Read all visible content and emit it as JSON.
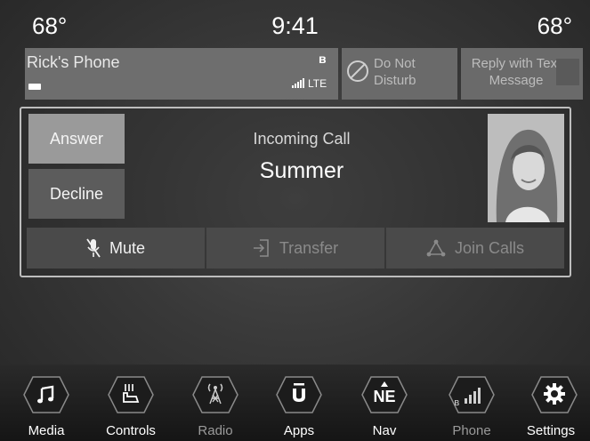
{
  "status_bar": {
    "temp_left": "68°",
    "time": "9:41",
    "temp_right": "68°"
  },
  "phone": {
    "name": "Rick's Phone",
    "network": "LTE",
    "do_not_disturb": "Do Not Disturb",
    "reply_text": "Reply with Text Message"
  },
  "call": {
    "status": "Incoming Call",
    "caller": "Summer",
    "answer_label": "Answer",
    "decline_label": "Decline",
    "mute_label": "Mute",
    "transfer_label": "Transfer",
    "join_label": "Join Calls"
  },
  "dock": [
    {
      "label": "Media",
      "icon": "music-note-icon"
    },
    {
      "label": "Controls",
      "icon": "heated-seat-icon"
    },
    {
      "label": "Radio",
      "icon": "radio-tower-icon"
    },
    {
      "label": "Apps",
      "icon": "apps-icon"
    },
    {
      "label": "Nav",
      "icon": "compass-ne-icon"
    },
    {
      "label": "Phone",
      "icon": "phone-signal-icon"
    },
    {
      "label": "Settings",
      "icon": "gear-icon"
    }
  ],
  "nav_glyph": "NE",
  "colors": {
    "background": "#383838",
    "answer_button": "#9a9a9a",
    "decline_button": "#5c5c5c"
  }
}
